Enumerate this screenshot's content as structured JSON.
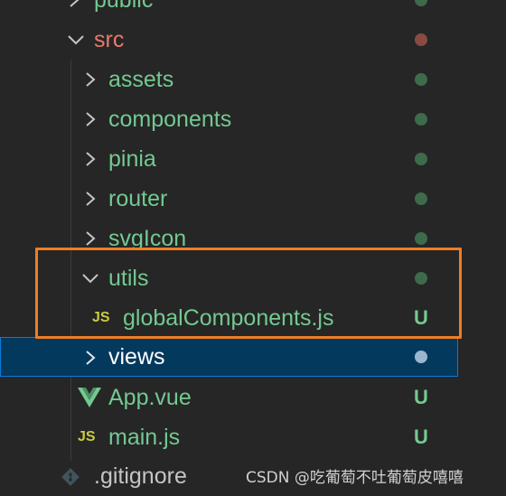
{
  "colors": {
    "background": "#262626",
    "folder_green": "#73c991",
    "folder_red": "#e77a6a",
    "dot_green": "#3d6b4c",
    "dot_red": "#8a4a44",
    "dot_selected": "#9ab7cf",
    "untracked": "#73c991",
    "selection_bg": "#04395e",
    "highlight_border": "#f07d22"
  },
  "tree": {
    "public": "public",
    "src": "src",
    "assets": "assets",
    "components": "components",
    "pinia": "pinia",
    "router": "router",
    "svgicon": "svgIcon",
    "utils": "utils",
    "global_components": "globalComponents.js",
    "views": "views",
    "app_vue": "App.vue",
    "main_js": "main.js",
    "gitignore": ".gitignore"
  },
  "icons": {
    "js_label": "JS",
    "vue": "vue-icon",
    "git": "git-icon"
  },
  "badges": {
    "untracked": "U"
  },
  "watermark": "CSDN @吃葡萄不吐葡萄皮嘻嘻"
}
